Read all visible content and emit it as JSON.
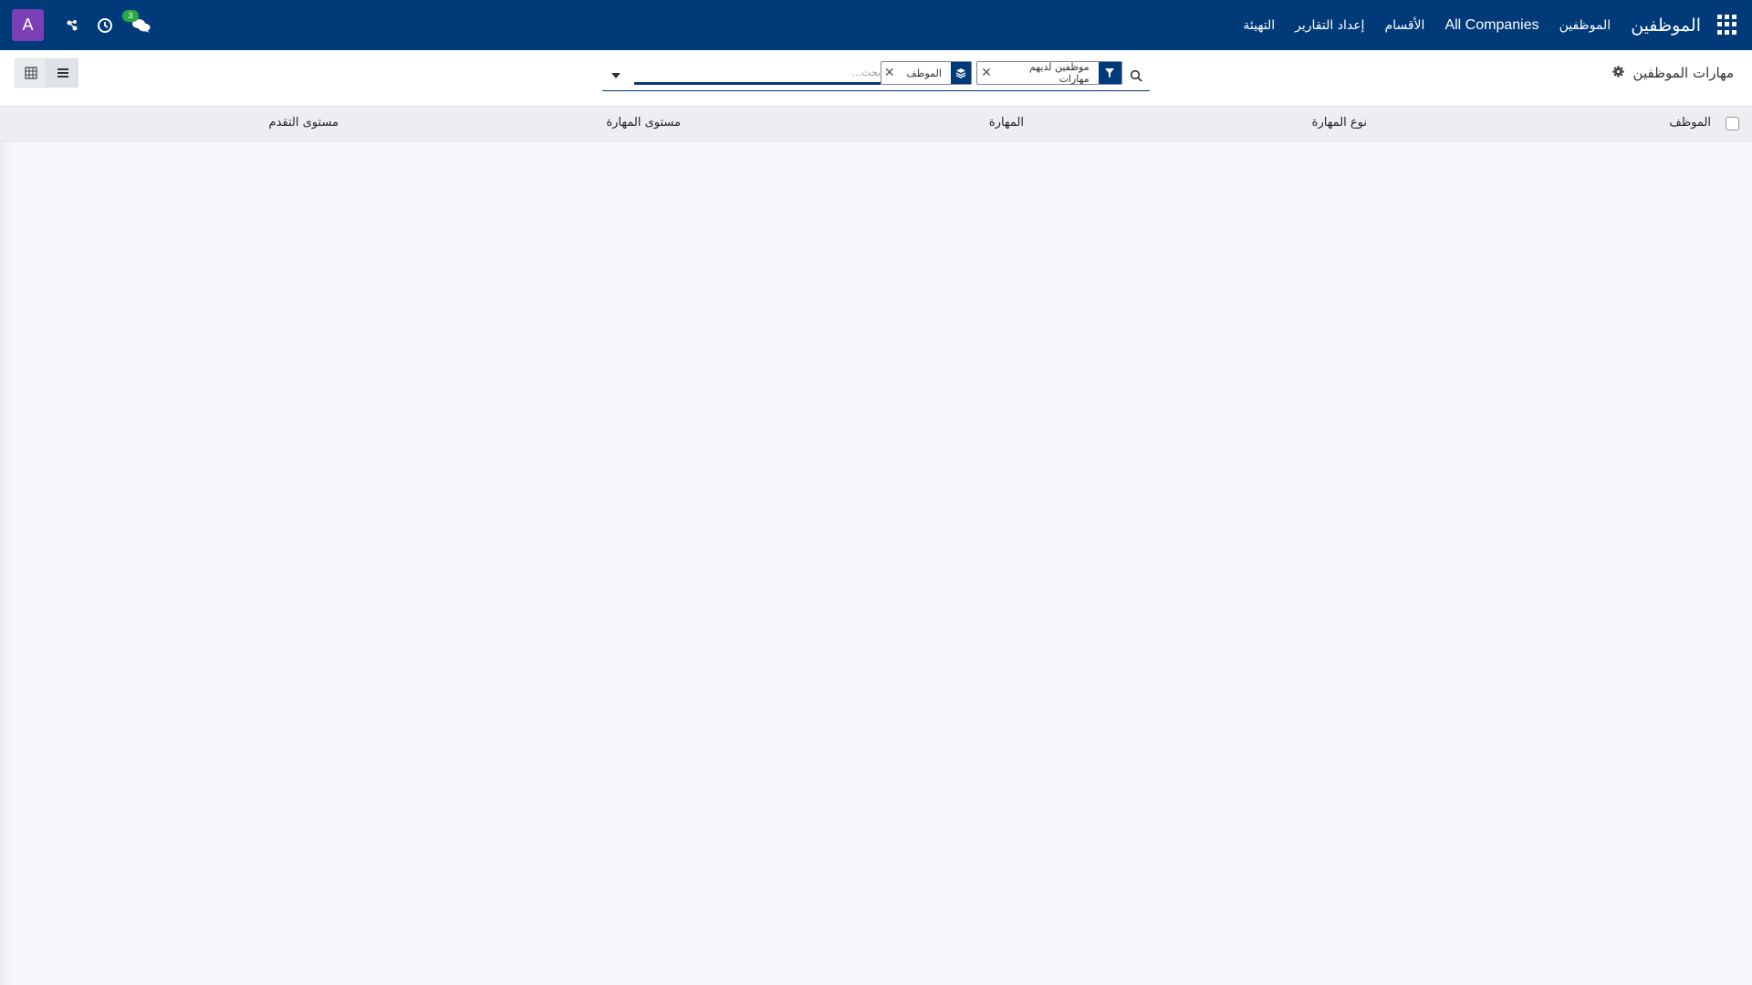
{
  "navbar": {
    "brand": "الموظفين",
    "menu": [
      "الموظفين",
      "All Companies",
      "الأقسام",
      "إعداد التقارير",
      "التهيئة"
    ],
    "avatar_letter": "A",
    "chat_badge": "3",
    "icons": [
      "apps-grid-icon",
      "chat-icon",
      "clock-icon",
      "users-icon"
    ],
    "color": "#003a78"
  },
  "control_panel": {
    "title": "مهارات الموظفين",
    "search": {
      "placeholder": "بحث...",
      "facets": [
        {
          "icon": "filter-icon",
          "value": "موظفين لديهم مهارات"
        },
        {
          "icon": "layers-icon",
          "value": "الموظف"
        }
      ]
    },
    "views": [
      "list-view-icon",
      "grid-view-icon"
    ]
  },
  "table": {
    "columns": [
      "الموظف",
      "نوع المهارة",
      "المهارة",
      "مستوى المهارة",
      "مستوى التقدم"
    ],
    "rows": []
  },
  "colors": {
    "primary": "#003a78",
    "avatar": "#7b3fb5",
    "badge": "#28a745"
  }
}
